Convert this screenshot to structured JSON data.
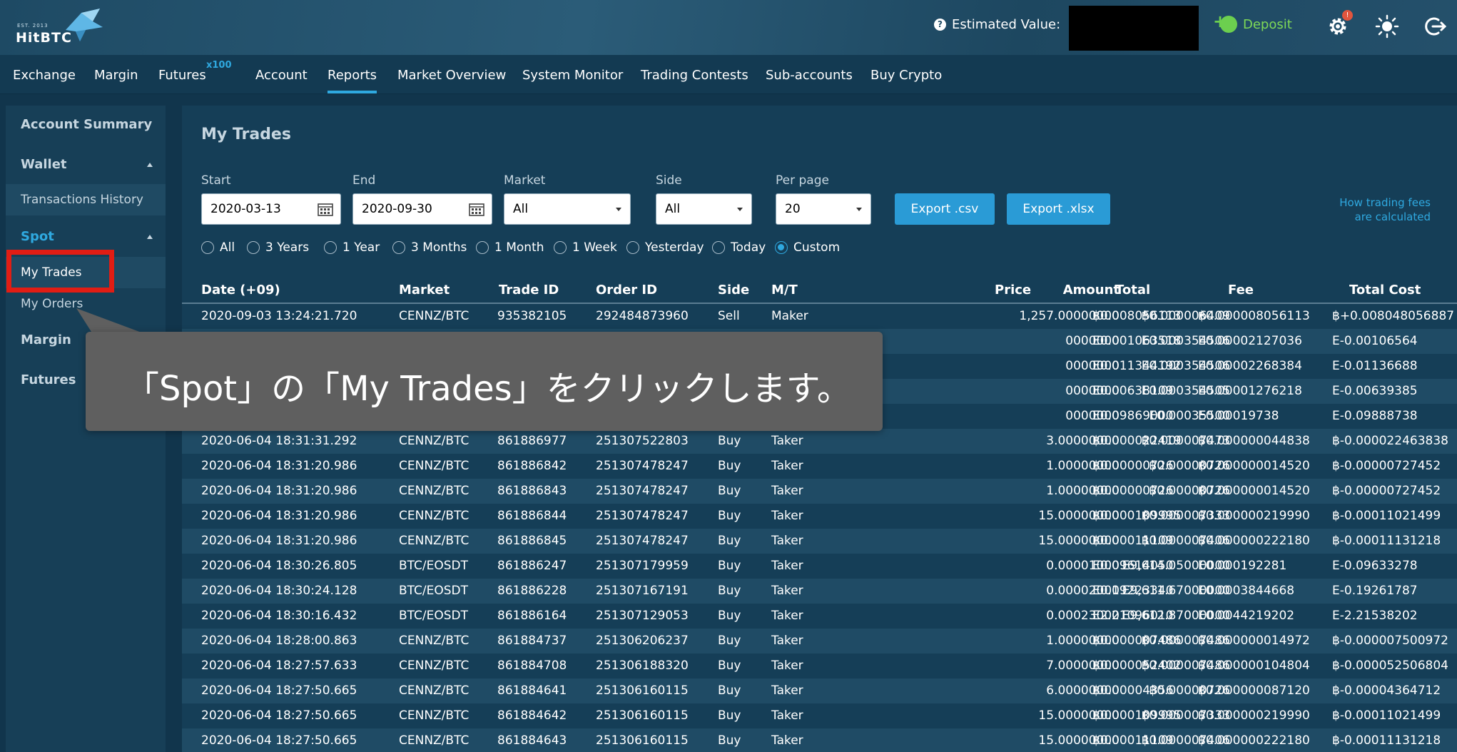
{
  "header": {
    "logo_est": "EST. 2013",
    "logo_name": "HitBTC",
    "estimated_value_label": "Estimated Value:",
    "deposit_label": "Deposit",
    "notification_badge": "!"
  },
  "nav": {
    "items": [
      "Exchange",
      "Margin",
      "Futures",
      "Account",
      "Reports",
      "Market Overview",
      "System Monitor",
      "Trading Contests",
      "Sub-accounts",
      "Buy Crypto"
    ],
    "futures_badge": "x100",
    "active": "Reports"
  },
  "sidebar": {
    "account_summary": "Account Summary",
    "wallet": "Wallet",
    "transactions_history": "Transactions History",
    "spot": "Spot",
    "my_trades": "My Trades",
    "my_orders": "My Orders",
    "margin": "Margin",
    "futures": "Futures"
  },
  "main": {
    "title": "My Trades",
    "filters": {
      "start_label": "Start",
      "start_value": "2020-03-13",
      "end_label": "End",
      "end_value": "2020-09-30",
      "market_label": "Market",
      "market_value": "All",
      "side_label": "Side",
      "side_value": "All",
      "perpage_label": "Per page",
      "perpage_value": "20"
    },
    "export_csv": "Export .csv",
    "export_xlsx": "Export .xlsx",
    "fee_link_line1": "How trading fees",
    "fee_link_line2": "are calculated",
    "periods": [
      "All",
      "3 Years",
      "1 Year",
      "3 Months",
      "1 Month",
      "1 Week",
      "Yesterday",
      "Today",
      "Custom"
    ],
    "selected_period": "Custom"
  },
  "table": {
    "headers": [
      "Date (+09)",
      "Market",
      "Trade ID",
      "Order ID",
      "Side",
      "M/T",
      "Amount",
      "Price",
      "Total",
      "Fee",
      "Total Cost"
    ],
    "rows": [
      [
        "2020-09-03 13:24:21.720",
        "CENNZ/BTC",
        "935382105",
        "292484873960",
        "Sell",
        "Maker",
        "1,257.00000000",
        "฿0.000006409",
        "฿0.008056113",
        "฿0.00000805611​3",
        "฿+0.00804805688​7"
      ],
      [
        "",
        "",
        "",
        "",
        "",
        "",
        "0000000",
        "E0.000354506",
        "E0.001063518",
        "E0.00002127036",
        "E-0.00106564"
      ],
      [
        "",
        "",
        "",
        "",
        "",
        "",
        "0000000",
        "E0.000354506",
        "E0.011344192",
        "E0.00002268384",
        "E-0.01136688"
      ],
      [
        "",
        "",
        "",
        "",
        "",
        "",
        "0000000",
        "E0.000354505",
        "E0.00638109",
        "E0.00001276218",
        "E-0.00639385"
      ],
      [
        "",
        "",
        "",
        "",
        "",
        "",
        "0000000",
        "E0.00035500",
        "E0.09869000",
        "E0.00019738",
        "E-0.09888738"
      ],
      [
        "2020-06-04 18:31:31.292",
        "CENNZ/BTC",
        "861886977",
        "251307522803",
        "Buy",
        "Taker",
        "3.00000000",
        "฿0.000007473",
        "฿0.000022419",
        "฿0.000000044838",
        "฿-0.000022463838"
      ],
      [
        "2020-06-04 18:31:20.986",
        "CENNZ/BTC",
        "861886842",
        "251307478247",
        "Buy",
        "Taker",
        "1.00000000",
        "฿0.00000726",
        "฿0.00000726",
        "฿0.000000014520",
        "฿-0.00000727452"
      ],
      [
        "2020-06-04 18:31:20.986",
        "CENNZ/BTC",
        "861886843",
        "251307478247",
        "Buy",
        "Taker",
        "1.00000000",
        "฿0.00000726",
        "฿0.00000726",
        "฿0.000000014520",
        "฿-0.00000727452"
      ],
      [
        "2020-06-04 18:31:20.986",
        "CENNZ/BTC",
        "861886844",
        "251307478247",
        "Buy",
        "Taker",
        "15.00000000",
        "฿0.000007333",
        "฿0.000109995",
        "฿0.000000219990",
        "฿-0.000110214​99"
      ],
      [
        "2020-06-04 18:31:20.986",
        "CENNZ/BTC",
        "861886845",
        "251307478247",
        "Buy",
        "Taker",
        "15.00000000",
        "฿0.000007406",
        "฿0.00011109",
        "฿0.000000222180",
        "฿-0.00011131218"
      ],
      [
        "2020-06-04 18:30:26.805",
        "BTC/EOSDT",
        "861886247",
        "251307179959",
        "Buy",
        "Taker",
        "0.00001000",
        "E9,614.05000000",
        "E0.09614050",
        "E0.000192281",
        "E-0.09633278"
      ],
      [
        "2020-06-04 18:30:24.128",
        "BTC/EOSDT",
        "861886228",
        "251307167191",
        "Buy",
        "Taker",
        "0.00002000",
        "E9,611.67000000",
        "E0.19223340",
        "E0.0003844668",
        "E-0.19261787"
      ],
      [
        "2020-06-04 18:30:16.432",
        "BTC/EOSDT",
        "861886164",
        "251307129053",
        "Buy",
        "Taker",
        "0.00023000",
        "E9,612.87000000",
        "E2.21096010",
        "E0.0044219202",
        "E-2.21538202"
      ],
      [
        "2020-06-04 18:28:00.863",
        "CENNZ/BTC",
        "861884737",
        "251306206237",
        "Buy",
        "Taker",
        "1.00000000",
        "฿0.000007486",
        "฿0.000007486",
        "฿0.000000014972",
        "฿-0.000007500972"
      ],
      [
        "2020-06-04 18:27:57.633",
        "CENNZ/BTC",
        "861884708",
        "251306188320",
        "Buy",
        "Taker",
        "7.00000000",
        "฿0.000007486",
        "฿0.000052402",
        "฿0.000000104804",
        "฿-0.000052506804"
      ],
      [
        "2020-06-04 18:27:50.665",
        "CENNZ/BTC",
        "861884641",
        "251306160115",
        "Buy",
        "Taker",
        "6.00000000",
        "฿0.00000726",
        "฿0.00004356",
        "฿0.000000087120",
        "฿-0.00004364712"
      ],
      [
        "2020-06-04 18:27:50.665",
        "CENNZ/BTC",
        "861884642",
        "251306160115",
        "Buy",
        "Taker",
        "15.00000000",
        "฿0.000007333",
        "฿0.000109995",
        "฿0.000000219990",
        "฿-0.00011021499"
      ],
      [
        "2020-06-04 18:27:50.665",
        "CENNZ/BTC",
        "861884643",
        "251306160115",
        "Buy",
        "Taker",
        "15.00000000",
        "฿0.000007406",
        "฿0.00011109",
        "฿0.000000222180",
        "฿-0.00011131218"
      ]
    ]
  },
  "callout": {
    "text": "「Spot」の「My Trades」をクリックします。"
  },
  "colors": {
    "accent": "#2fa9e0",
    "deposit": "#7ed957",
    "highlight": "#e11d14"
  }
}
